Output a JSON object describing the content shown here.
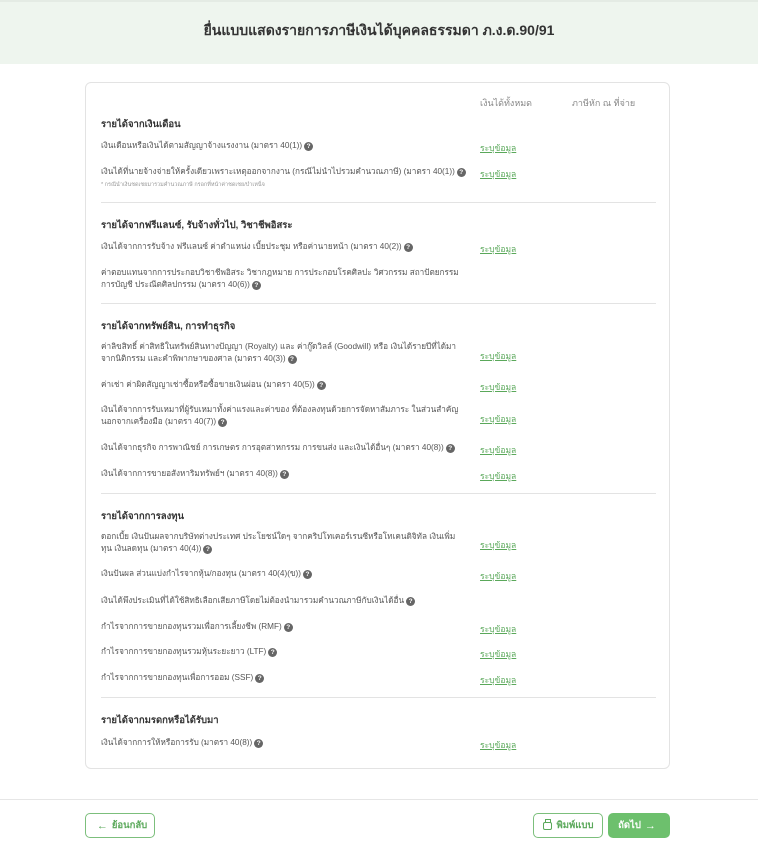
{
  "header": {
    "title": "ยื่นแบบแสดงรายการภาษีเงินได้บุคคลธรรมดา ภ.ง.ด.90/91"
  },
  "table": {
    "col_total": "เงินได้ทั้งหมด",
    "col_tax": "ภาษีหัก ณ ที่จ่าย",
    "fill_label": "ระบุข้อมูล",
    "help_glyph": "?"
  },
  "sections": [
    {
      "title": "รายได้จากเงินเดือน",
      "rows": [
        {
          "label": "เงินเดือนหรือเงินได้ตามสัญญาจ้างแรงงาน (มาตรา 40(1))",
          "fill": true
        },
        {
          "label": "เงินได้ที่นายจ้างจ่ายให้ครั้งเดียวเพราะเหตุออกจากงาน (กรณีไม่นำไปรวมคำนวณภาษี) (มาตรา 40(1))",
          "fill": true,
          "note": "* กรณีนำเงินชดเชยมารวมคำนวณภาษี กรอกที่หน้าค่าชดเชย/บำเหน็จ"
        }
      ]
    },
    {
      "title": "รายได้จากฟรีแลนซ์, รับจ้างทั่วไป, วิชาชีพอิสระ",
      "rows": [
        {
          "label": "เงินได้จากการรับจ้าง ฟรีแลนซ์ ค่าตำแหน่ง เบี้ยประชุม หรือค่านายหน้า (มาตรา 40(2))",
          "fill": true
        },
        {
          "label": "ค่าตอบแทนจากการประกอบวิชาชีพอิสระ วิชากฎหมาย การประกอบโรคศิลปะ วิศวกรรม สถาปัตยกรรม การบัญชี ประณีตศิลปกรรม (มาตรา 40(6))",
          "fill": false
        }
      ]
    },
    {
      "title": "รายได้จากทรัพย์สิน, การทำธุรกิจ",
      "rows": [
        {
          "label": "ค่าลิขสิทธิ์ ค่าสิทธิในทรัพย์สินทางปัญญา (Royalty) และ ค่ากู๊ดวิลล์ (Goodwill) หรือ เงินได้รายปีที่ได้มาจากนิติกรรม และคำพิพากษาของศาล (มาตรา 40(3))",
          "fill": true
        },
        {
          "label": "ค่าเช่า ค่าผิดสัญญาเช่าซื้อหรือซื้อขายเงินผ่อน (มาตรา 40(5))",
          "fill": true
        },
        {
          "label": "เงินได้จากการรับเหมาที่ผู้รับเหมาทั้งค่าแรงและค่าของ ที่ต้องลงทุนด้วยการจัดหาสัมภาระ ในส่วนสำคัญนอกจากเครื่องมือ (มาตรา 40(7))",
          "fill": true
        },
        {
          "label": "เงินได้จากธุรกิจ การพาณิชย์ การเกษตร การอุตสาหกรรม การขนส่ง และเงินได้อื่นๆ (มาตรา 40(8))",
          "fill": true
        },
        {
          "label": "เงินได้จากการขายอสังหาริมทรัพย์ฯ (มาตรา 40(8))",
          "fill": true
        }
      ]
    },
    {
      "title": "รายได้จากการลงทุน",
      "rows": [
        {
          "label": "ดอกเบี้ย เงินปันผลจากบริษัทต่างประเทศ ประโยชน์ใดๆ จากคริปโทเคอร์เรนซีหรือโทเคนดิจิทัล เงินเพิ่มทุน เงินลดทุน (มาตรา 40(4))",
          "fill": true
        },
        {
          "label": "เงินปันผล ส่วนแบ่งกำไรจากหุ้น/กองทุน (มาตรา 40(4)(ข))",
          "fill": true
        },
        {
          "label": "เงินได้พึงประเมินที่ได้ใช้สิทธิเลือกเสียภาษีโดยไม่ต้องนำมารวมคำนวณภาษีกับเงินได้อื่น",
          "fill": false
        },
        {
          "label": "กำไรจากการขายกองทุนรวมเพื่อการเลี้ยงชีพ (RMF)",
          "fill": true
        },
        {
          "label": "กำไรจากการขายกองทุนรวมหุ้นระยะยาว (LTF)",
          "fill": true
        },
        {
          "label": "กำไรจากการขายกองทุนเพื่อการออม (SSF)",
          "fill": true
        }
      ]
    },
    {
      "title": "รายได้จากมรดกหรือได้รับมา",
      "rows": [
        {
          "label": "เงินได้จากการให้หรือการรับ (มาตรา 40(8))",
          "fill": true
        }
      ]
    }
  ],
  "footer": {
    "back_label": "ย้อนกลับ",
    "print_label": "พิมพ์แบบ",
    "next_label": "ถัดไป",
    "back_arrow": "←",
    "next_arrow": "→"
  },
  "colors": {
    "accent": "#6dc06d",
    "link": "#5aa85a",
    "header_bg": "#eef5ee"
  }
}
